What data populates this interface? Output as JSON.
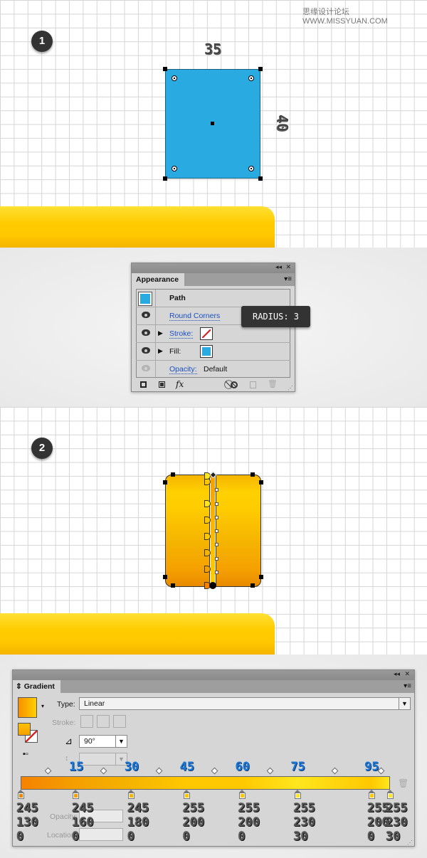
{
  "watermark": "思缘设计论坛 WWW.MISSYUAN.COM",
  "step1": {
    "badge": "1",
    "width_label": "35",
    "height_label": "40",
    "shape_color": "#29abe2"
  },
  "appearance": {
    "tab": "Appearance",
    "title": "Path",
    "rows": [
      {
        "label": "Round Corners"
      },
      {
        "label": "Stroke:"
      },
      {
        "label": "Fill:"
      },
      {
        "label": "Opacity:",
        "value": "Default"
      }
    ],
    "tooltip": "RADIUS: 3",
    "icons": [
      "add-new-stroke-icon",
      "add-new-fill-icon",
      "fx-icon",
      "clear-appearance-icon",
      "duplicate-item-icon",
      "delete-item-icon"
    ],
    "fx_label": "fx"
  },
  "step2": {
    "badge": "2"
  },
  "gradient": {
    "tab": "Gradient",
    "type_label": "Type:",
    "type_value": "Linear",
    "stroke_label": "Stroke:",
    "angle_value": "90°",
    "opacity_label": "Opacity:",
    "location_label": "Location:",
    "stops": [
      {
        "location": 0,
        "rgb": [
          245,
          130,
          0
        ],
        "show_location": false
      },
      {
        "location": 15,
        "rgb": [
          245,
          160,
          0
        ],
        "show_location": true
      },
      {
        "location": 30,
        "rgb": [
          245,
          180,
          0
        ],
        "show_location": true
      },
      {
        "location": 45,
        "rgb": [
          255,
          200,
          0
        ],
        "show_location": true
      },
      {
        "location": 60,
        "rgb": [
          255,
          200,
          0
        ],
        "show_location": true
      },
      {
        "location": 75,
        "rgb": [
          255,
          230,
          30
        ],
        "show_location": true
      },
      {
        "location": 95,
        "rgb": [
          255,
          200,
          0
        ],
        "show_location": true
      },
      {
        "location": 100,
        "rgb": [
          255,
          230,
          30
        ],
        "show_location": false
      }
    ]
  }
}
